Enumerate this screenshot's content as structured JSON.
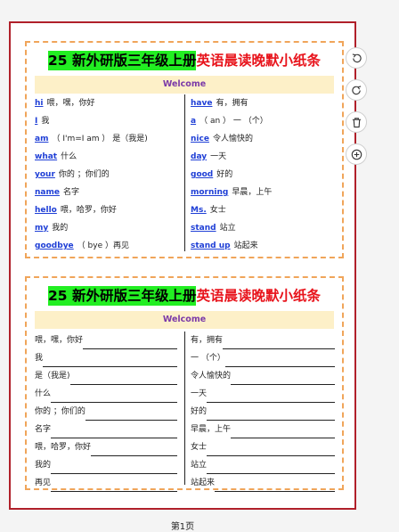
{
  "cards": [
    {
      "title_highlight": "25 新外研版三年级上册",
      "title_rest": "英语晨读晚默小纸条",
      "welcome": "Welcome",
      "left": [
        {
          "en": "hi",
          "zh": "喂，嘿，你好"
        },
        {
          "en": "I",
          "zh": "我"
        },
        {
          "en": "am",
          "zh": "（ I'm=I am ）  是（我是)"
        },
        {
          "en": "what",
          "zh": "什么"
        },
        {
          "en": "your",
          "zh": "你的 ；你们的"
        },
        {
          "en": "name",
          "zh": "名字"
        },
        {
          "en": "hello",
          "zh": "喂，哈罗，你好"
        },
        {
          "en": "my",
          "zh": "我的"
        },
        {
          "en": "goodbye",
          "zh": "（ bye ）再见"
        }
      ],
      "right": [
        {
          "en": "have",
          "zh": "有，拥有"
        },
        {
          "en": "a",
          "zh": "（ an ）  一 （个）"
        },
        {
          "en": "nice",
          "zh": "令人愉快的"
        },
        {
          "en": "day",
          "zh": "一天"
        },
        {
          "en": "good",
          "zh": "好的"
        },
        {
          "en": "morning",
          "zh": "早晨，上午"
        },
        {
          "en": "Ms.",
          "zh": "女士"
        },
        {
          "en": "stand",
          "zh": "站立"
        },
        {
          "en": "stand up",
          "zh": "站起来"
        }
      ]
    },
    {
      "title_highlight": "25 新外研版三年级上册",
      "title_rest": "英语晨读晚默小纸条",
      "welcome": "Welcome",
      "left": [
        "喂，嘿，你好",
        "我",
        "是（我是)",
        "什么",
        "你的 ；你们的",
        "名字",
        "喂，哈罗，你好",
        "我的",
        "再见"
      ],
      "right": [
        "有，拥有",
        "一 （个）",
        "令人愉快的",
        "一天",
        "好的",
        "早晨，上午",
        "女士",
        "站立",
        "站起来"
      ]
    }
  ],
  "toolbar": [
    "rotate-left-icon",
    "rotate-right-icon",
    "delete-icon",
    "add-icon"
  ],
  "page_label": "第1页"
}
